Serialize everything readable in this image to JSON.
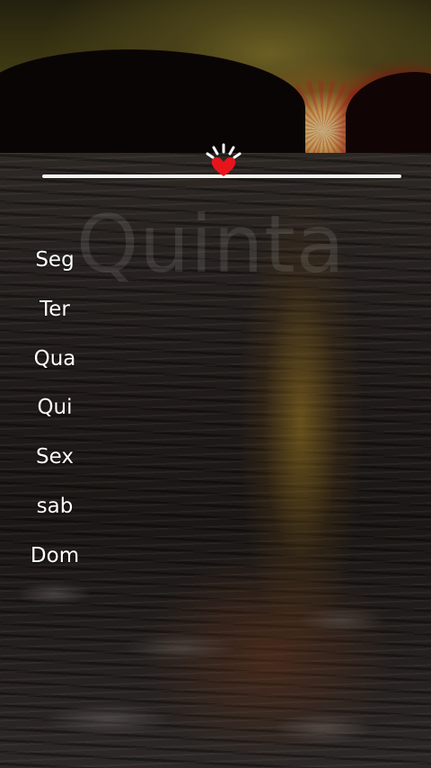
{
  "background": {
    "scene": "sunset-over-water-photo"
  },
  "slider": {
    "thumb_icon": "heart-icon",
    "thumb_color": "#e8141c",
    "track_color": "#f4f4f4"
  },
  "watermark": {
    "text": "Quinta"
  },
  "days": [
    {
      "label": "Seg"
    },
    {
      "label": "Ter"
    },
    {
      "label": "Qua"
    },
    {
      "label": "Qui"
    },
    {
      "label": "Sex"
    },
    {
      "label": "sab"
    },
    {
      "label": "Dom"
    }
  ]
}
